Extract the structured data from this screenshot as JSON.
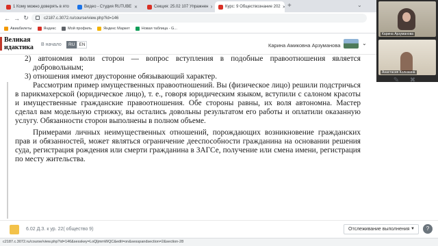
{
  "browser": {
    "tabs": [
      {
        "title": "1 Кому можно доверять в ято",
        "favicon_color": "#d93025"
      },
      {
        "title": "Видео - Студия RUTUBE",
        "favicon_color": "#1a73e8"
      },
      {
        "title": "Секция: 25.02 107 Упражнен",
        "favicon_color": "#d93025"
      },
      {
        "title": "Курс: 9 Обществознание 202",
        "favicon_color": "#d93025"
      }
    ],
    "new_tab": "+",
    "tab_search": "⌄",
    "url": "c2187.c.3072.ru/course/view.php?id=146",
    "back": "←",
    "forward": "→",
    "reload": "↻",
    "bookmarks": [
      {
        "label": "Авиабилеты",
        "color": "#f29900"
      },
      {
        "label": "Яндекс",
        "color": "#d93025"
      },
      {
        "label": "Мой профиль",
        "color": "#5f6368"
      },
      {
        "label": "Яндекс Маркет",
        "color": "#f4b400"
      },
      {
        "label": "Новая таблица - G...",
        "color": "#0f9d58"
      }
    ]
  },
  "site": {
    "logo_line1": "Великая",
    "logo_line2": "идактика",
    "home_link": "В начало",
    "lang_ru": "RU",
    "lang_en": "EN",
    "user_name": "Карина Амиковна Арзуманова",
    "user_caret": "⌄",
    "accent_color": "#c0392b"
  },
  "document": {
    "item2": "2) автономия воли сторон — вопрос вступления в подобные правоотношения является добровольным;",
    "item3": "3) отношения имеют двусторонне обязывающий характер.",
    "para1": "Рассмотрим пример имущественных правоотношений. Вы (физическое лицо) решили подстричься в парикмахерской (юридическое лицо), т. е., говоря юридическим языком, вступили с салоном красоты и имущественные гражданские правоотношения. Обе стороны равны, их воля автономна. Мастер сделал вам модельную стрижку, вы остались довольны результатом его работы и оплатили оказанную услугу. Обязанности сторон выполнены в полном объеме.",
    "para2": "Примерами личных неимущественных отношений, порождающих возникновение гражданских прав и обязанностей, может являться ограничение дееспособности гражданина на основании решения суда, регистрация рождения или смерти гражданина в ЗАГСе, получение или смена имени, регистрация по месту жительства."
  },
  "controls": {
    "edit_icon": "✎",
    "close_icon": "✖"
  },
  "footer": {
    "file_link": "6.02 Д.З. к ур. 22( общество 9)",
    "tracking_label": "Отслеживание выполнения",
    "tracking_caret": "▼",
    "help": "?"
  },
  "status_url": "c2187.c.3072.ru/course/view.php?id=146&sesskey=LoQljmmWQC&edit=on&sesspandsection=2&section-28",
  "video": {
    "participant1": "Карина Арзуманова",
    "participant2": "Анастасия Колюкина"
  }
}
